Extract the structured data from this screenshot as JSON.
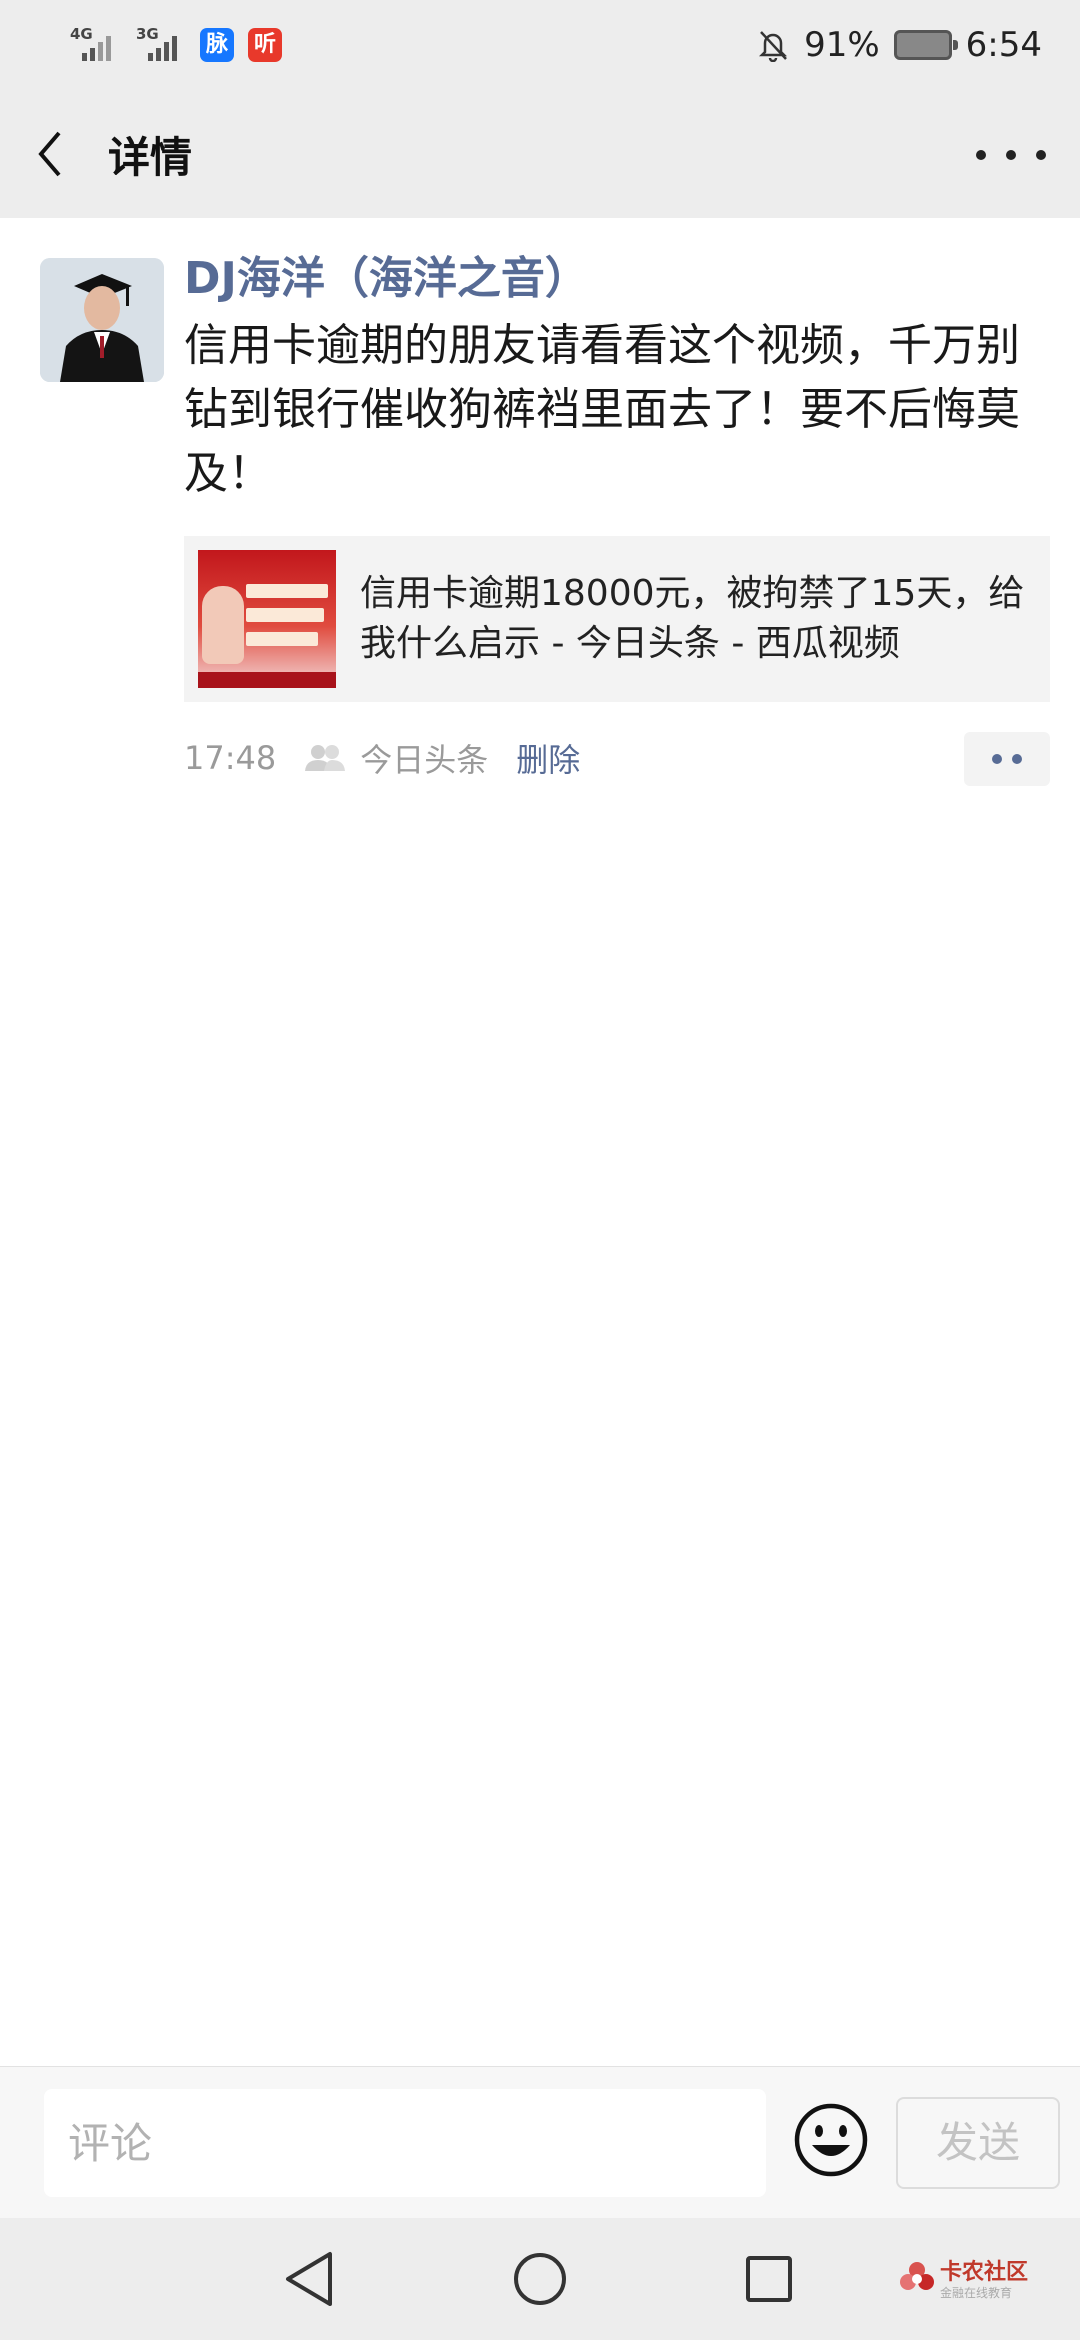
{
  "status_bar": {
    "net1": "4G",
    "net2": "3G",
    "app1": "脉",
    "app2": "听",
    "battery": "91%",
    "time": "6:54"
  },
  "nav": {
    "title": "详情"
  },
  "post": {
    "author": "DJ海洋（海洋之音）",
    "content": "信用卡逾期的朋友请看看这个视频，千万别钻到银行催收狗裤裆里面去了！要不后悔莫及！",
    "link_title": "信用卡逾期18000元，被拘禁了15天，给我什么启示 - 今日头条 - 西瓜视频",
    "time": "17:48",
    "visibility": "今日头条",
    "delete_label": "删除"
  },
  "comment": {
    "placeholder": "评论",
    "send_label": "发送"
  },
  "watermark": {
    "name": "卡农社区",
    "tagline": "金融在线教育"
  }
}
